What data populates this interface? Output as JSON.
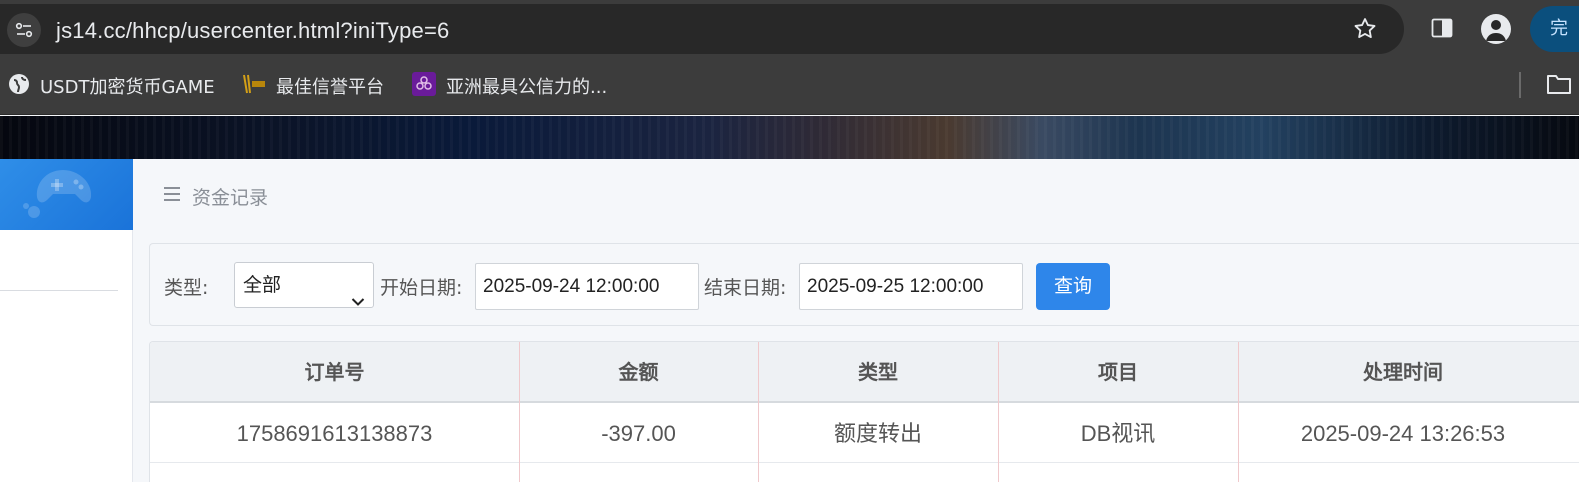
{
  "browser": {
    "url": "js14.cc/hhcp/usercenter.html?iniType=6",
    "done_label": "完",
    "icons": [
      "site-info-icon",
      "star-icon",
      "side-panel-icon",
      "profile-icon",
      "folder-icon"
    ],
    "bookmarks": [
      {
        "label": "USDT加密货币GAME",
        "icon": "globe-icon"
      },
      {
        "label": "最佳信誉平台",
        "icon": "game-logo-icon"
      },
      {
        "label": "亚洲最具公信力的...",
        "icon": "flower-icon"
      }
    ]
  },
  "page": {
    "title": "资金记录",
    "menu_icon": "menu-icon"
  },
  "filter": {
    "type_label": "类型:",
    "type_value": "全部",
    "start_label": "开始日期:",
    "start_value": "2025-09-24 12:00:00",
    "end_label": "结束日期:",
    "end_value": "2025-09-25 12:00:00",
    "query_label": "查询"
  },
  "table": {
    "headers": [
      "订单号",
      "金额",
      "类型",
      "项目",
      "处理时间"
    ],
    "rows": [
      [
        "1758691613138873",
        "-397.00",
        "额度转出",
        "DB视讯",
        "2025-09-24 13:26:53"
      ]
    ]
  },
  "colors": {
    "accent": "#2e86ea",
    "sidebar_header": "#1a73d9",
    "chrome_bg": "#3c3c3c"
  }
}
